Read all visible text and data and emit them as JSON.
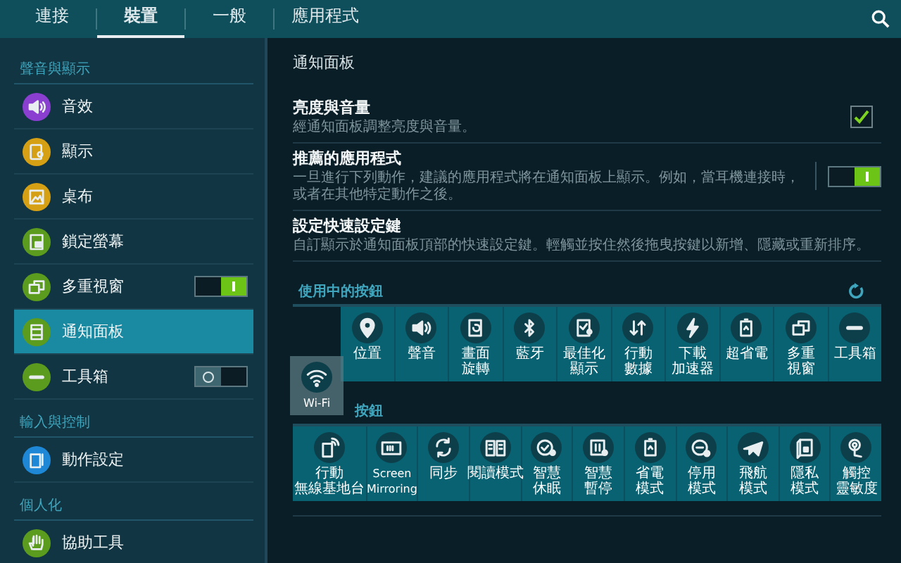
{
  "tabs": [
    {
      "label": "連接",
      "selected": false
    },
    {
      "label": "裝置",
      "selected": true
    },
    {
      "label": "一般",
      "selected": false
    },
    {
      "label": "應用程式",
      "selected": false
    }
  ],
  "sidebar": {
    "sections": [
      {
        "header": "聲音與顯示",
        "items": [
          {
            "label": "音效",
            "kind": "plain",
            "selected": false
          },
          {
            "label": "顯示",
            "kind": "plain",
            "selected": false
          },
          {
            "label": "桌布",
            "kind": "plain",
            "selected": false
          },
          {
            "label": "鎖定螢幕",
            "kind": "plain",
            "selected": false
          },
          {
            "label": "多重視窗",
            "kind": "toggle",
            "on": true,
            "selected": false
          },
          {
            "label": "通知面板",
            "kind": "plain",
            "selected": true
          },
          {
            "label": "工具箱",
            "kind": "toggle",
            "on": false,
            "selected": false
          }
        ]
      },
      {
        "header": "輸入與控制",
        "items": [
          {
            "label": "動作設定",
            "kind": "plain",
            "selected": false
          }
        ]
      },
      {
        "header": "個人化",
        "items": [
          {
            "label": "協助工具",
            "kind": "plain",
            "selected": false
          }
        ]
      }
    ]
  },
  "panel": {
    "title": "通知面板",
    "settings": [
      {
        "kind": "checkbox",
        "title": "亮度與音量",
        "description": "經通知面板調整亮度與音量。",
        "checked": true
      },
      {
        "kind": "toggle",
        "title": "推薦的應用程式",
        "description": "一旦進行下列動作，建議的應用程式將在通知面板上顯示。例如，當耳機連接時，或者在其他特定動作之後。",
        "on": true
      },
      {
        "kind": "plain",
        "title": "設定快速設定鍵",
        "description": "自訂顯示於通知面板頂部的快速設定鍵。輕觸並按住然後拖曳按鍵以新增、隱藏或重新排序。"
      }
    ],
    "active_buttons": {
      "header": "使用中的按鈕",
      "tiles": [
        {
          "lines": [
            "位置"
          ]
        },
        {
          "lines": [
            "聲音"
          ]
        },
        {
          "lines": [
            "畫面",
            "旋轉"
          ]
        },
        {
          "lines": [
            "藍牙"
          ]
        },
        {
          "lines": [
            "最佳化",
            "顯示"
          ]
        },
        {
          "lines": [
            "行動",
            "數據"
          ]
        },
        {
          "lines": [
            "下載",
            "加速器"
          ]
        },
        {
          "lines": [
            "超省電"
          ]
        },
        {
          "lines": [
            "多重",
            "視窗"
          ]
        },
        {
          "lines": [
            "工具箱"
          ]
        }
      ]
    },
    "dragged_tile": {
      "lines": [
        "Wi-Fi"
      ]
    },
    "available_buttons": {
      "header": "按鈕",
      "tiles": [
        {
          "lines": [
            "行動",
            "無線基地台"
          ]
        },
        {
          "lines": [
            "Screen",
            "Mirroring"
          ]
        },
        {
          "lines": [
            "同步"
          ]
        },
        {
          "lines": [
            "閱讀模式"
          ]
        },
        {
          "lines": [
            "智慧",
            "休眠"
          ]
        },
        {
          "lines": [
            "智慧",
            "暫停"
          ]
        },
        {
          "lines": [
            "省電",
            "模式"
          ]
        },
        {
          "lines": [
            "停用",
            "模式"
          ]
        },
        {
          "lines": [
            "飛航",
            "模式"
          ]
        },
        {
          "lines": [
            "隱私",
            "模式"
          ]
        },
        {
          "lines": [
            "觸控",
            "靈敏度"
          ]
        }
      ]
    }
  }
}
